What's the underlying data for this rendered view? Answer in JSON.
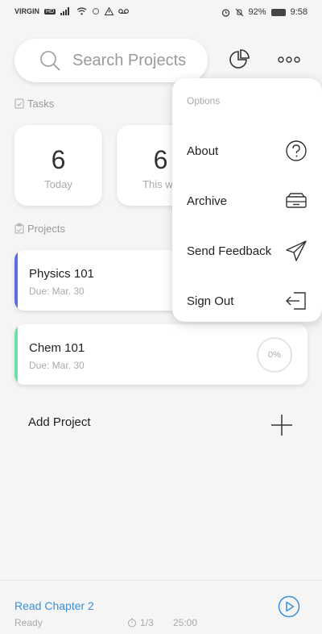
{
  "status_bar": {
    "carrier": "VIRGIN",
    "network_badge": "HD",
    "battery": "92%",
    "time": "9:58"
  },
  "search": {
    "placeholder": "Search Projects"
  },
  "tasks_section": {
    "label": "Tasks",
    "cards": [
      {
        "count": "6",
        "caption": "Today"
      },
      {
        "count": "6",
        "caption": "This we"
      }
    ]
  },
  "projects_section": {
    "label": "Projects",
    "items": [
      {
        "name": "Physics 101",
        "due": "Due: Mar. 30",
        "accent": "#5b6ee1"
      },
      {
        "name": "Chem 101",
        "due": "Due: Mar. 30",
        "accent": "#6ee0a8",
        "progress": "0%"
      }
    ],
    "add_label": "Add Project"
  },
  "options_menu": {
    "header": "Options",
    "items": [
      {
        "label": "About",
        "icon": "help-circle-icon"
      },
      {
        "label": "Archive",
        "icon": "archive-box-icon"
      },
      {
        "label": "Send Feedback",
        "icon": "send-icon"
      },
      {
        "label": "Sign Out",
        "icon": "sign-out-icon"
      }
    ]
  },
  "bottom_bar": {
    "task_title": "Read Chapter 2",
    "task_status": "Ready",
    "session": "1/3",
    "timer": "25:00"
  },
  "colors": {
    "accent_blue": "#3a8fd6",
    "physics_accent": "#5b6ee1",
    "chem_accent": "#6ee0a8"
  }
}
